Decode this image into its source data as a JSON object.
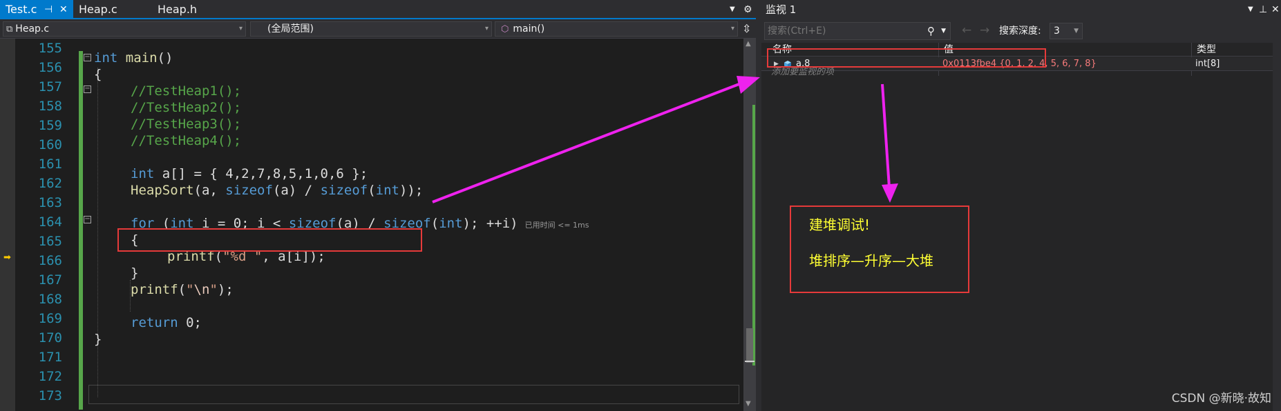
{
  "editor": {
    "tabs": [
      {
        "label": "Test.c",
        "active": true
      },
      {
        "label": "Heap.c",
        "active": false
      },
      {
        "label": "Heap.h",
        "active": false
      }
    ],
    "nav": {
      "file": "Heap.c",
      "scope": "(全局范围)",
      "function": "main()"
    },
    "lines": [
      {
        "num": "155"
      },
      {
        "num": "156"
      },
      {
        "num": "157"
      },
      {
        "num": "158"
      },
      {
        "num": "159"
      },
      {
        "num": "160"
      },
      {
        "num": "161"
      },
      {
        "num": "162"
      },
      {
        "num": "163"
      },
      {
        "num": "164"
      },
      {
        "num": "165"
      },
      {
        "num": "166"
      },
      {
        "num": "167"
      },
      {
        "num": "168"
      },
      {
        "num": "169"
      },
      {
        "num": "170"
      },
      {
        "num": "171"
      },
      {
        "num": "172"
      },
      {
        "num": "173"
      }
    ],
    "code": {
      "l156_kw": "int",
      "l156_fn": "main",
      "l156_rest": "()",
      "l157": "{",
      "l158": "//TestHeap1();",
      "l159": "//TestHeap2();",
      "l160": "//TestHeap3();",
      "l161": "//TestHeap4();",
      "l163_kw": "int",
      "l163_rest": " a[] = { 4,2,7,8,5,1,0,6 };",
      "l164_fn": "HeapSort",
      "l164_a": "(a, ",
      "l164_kw1": "sizeof",
      "l164_b": "(a) / ",
      "l164_kw2": "sizeof",
      "l164_c": "(",
      "l164_kw3": "int",
      "l164_d": "));",
      "l166_kw1": "for",
      "l166_a": " (",
      "l166_kw2": "int",
      "l166_b": " i = 0; i < ",
      "l166_kw3": "sizeof",
      "l166_c": "(a) / ",
      "l166_kw4": "sizeof",
      "l166_d": "(",
      "l166_kw5": "int",
      "l166_e": "); ++i)",
      "l166_perf": "已用时间 <= 1ms",
      "l167": "{",
      "l168_fn": "printf",
      "l168_a": "(",
      "l168_str": "\"%d \"",
      "l168_b": ", a[i]);",
      "l169": "}",
      "l170_fn": "printf",
      "l170_a": "(",
      "l170_str1": "\"",
      "l170_esc": "\\n",
      "l170_str2": "\"",
      "l170_b": ");",
      "l172_kw": "return",
      "l172_rest": " 0;",
      "l173": "}"
    }
  },
  "watch": {
    "title": "监视 1",
    "search_placeholder": "搜索(Ctrl+E)",
    "depth_label": "搜索深度:",
    "depth_value": "3",
    "columns": {
      "name": "名称",
      "value": "值",
      "type": "类型"
    },
    "rows": [
      {
        "name": "a,8",
        "value": "0x0113fbe4 {0, 1, 2, 4, 5, 6, 7, 8}",
        "type": "int[8]"
      }
    ],
    "add_placeholder": "添加要监视的项"
  },
  "annotation": {
    "line1": "建堆调试!",
    "line2": "堆排序—升序—大堆",
    "arrow_color": "#ee22ee",
    "box_color": "#e63a3a"
  },
  "watermark": "CSDN @新晓·故知",
  "colors": {
    "accent": "#007acc",
    "keyword": "#569cd6",
    "function": "#dcdcaa",
    "comment": "#57a64a",
    "line_number": "#2b91af",
    "watch_value": "#f77b7b",
    "note_text": "#ffff33"
  }
}
